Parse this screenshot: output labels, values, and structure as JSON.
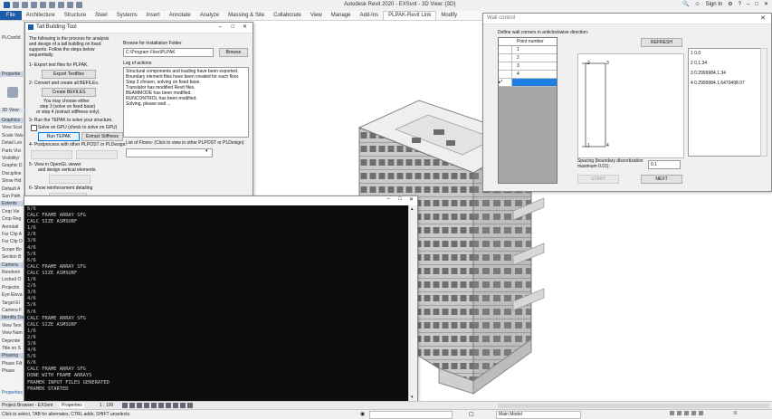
{
  "app": {
    "title": "Autodesk Revit 2020 - EXSvnt - 3D View: {3D}",
    "sign_in": "Sign In"
  },
  "ribbon": {
    "tabs": [
      "File",
      "Architecture",
      "Structure",
      "Steel",
      "Systems",
      "Insert",
      "Annotate",
      "Analyze",
      "Massing & Site",
      "Collaborate",
      "View",
      "Manage",
      "Add-Ins",
      "PLPAK-Revit Link",
      "Modify"
    ]
  },
  "left_panel": {
    "top_label": "PLConfid",
    "properties_label": "Propertie",
    "view_label": "3D View:",
    "rows": [
      "Graphics",
      "View Scal",
      "Scale Valu",
      "Detail Lev",
      "Parts Visi",
      "Visibility/",
      "Graphic D",
      "Discipline",
      "Show Hid",
      "Default A",
      "Sun Path",
      "Extents",
      "Crop Vie",
      "Crop Reg",
      "Annotati",
      "Far Clip A",
      "Far Clip O",
      "Scope Bo",
      "Section B",
      "Camera",
      "Renderin",
      "Locked O",
      "Projectio",
      "Eye Eleva",
      "Target El",
      "Camera F",
      "Identity Da",
      "View Tem",
      "View Nam",
      "Depende",
      "Title on S",
      "Phasing",
      "Phase Filt",
      "Phase"
    ],
    "properties_link": "Properties"
  },
  "tall_building": {
    "title": "Tall Building Tool",
    "intro": [
      "The following is the process for analysis",
      "and design of a tall building on fixed",
      "supports. Follow the steps below",
      "sequentially."
    ],
    "step1": "1- Export text files for PLPAK.",
    "export_button": "Export Textfiles",
    "step2": "2- Convert and create all BEFILEs.",
    "create_button": "Create BEFILES",
    "choose_note": [
      "You may choose either",
      "step 3 (solve on fixed base)",
      "or step 4 (extract stiffness only)."
    ],
    "step3": "3- Run the TEPAK to solve your structure.",
    "gpu_checkbox": "Solve on GPU (check to solve on GPU)",
    "run_button": "Run TEPAK",
    "extract_button": "Extract Stiffness",
    "step4": "4- Postprocess with other PLPOST or PLDesign.",
    "step5": "5- View in OpenGL viewer",
    "step5b": "and design vertical elements.",
    "step6": "6- Show reinforcement detailing",
    "browse_label": "Browse for Installation Folder",
    "path_value": "C:\\Program Files\\PLPAK",
    "browse_button": "Browse",
    "log_label": "Log of actions:",
    "log_lines": [
      "Structural components and loading have been exported.",
      "Boundary element files have been created for each floor.",
      "Step 3 chosen, solving on fixed base.",
      "Translator has modified Revit files.",
      "BEAMMODE has been modified.",
      "RUNCONTROL has been modified.",
      "Solving, please wait ..."
    ],
    "floors_label": "List of Floors: (Click to view in other PLPOST or PLDesign)"
  },
  "console": {
    "lines": [
      "6/6",
      "CALC FRAME ARRAY SFG",
      "CALC SIZE ASMSURF",
      "1/6",
      "2/6",
      "3/6",
      "4/6",
      "5/6",
      "6/6",
      "CALC FRAME ARRAY SFG",
      "CALC SIZE ASMSURF",
      "1/6",
      "2/6",
      "3/6",
      "4/6",
      "5/6",
      "6/6",
      "CALC FRAME ARRAY SFG",
      "CALC SIZE ASMSURF",
      "1/6",
      "2/6",
      "3/6",
      "4/6",
      "5/6",
      "6/6",
      "CALC FRAME ARRAY SFG",
      "DONE WITH FRAME ARRAYS",
      "FRAMEK INPUT FILES GENERATED",
      "FRAMEK STARTED"
    ]
  },
  "wall_control": {
    "title": "Wall control",
    "instruction": "Define wall corners in anticlockwise direction:",
    "table_header": "Point number",
    "table_rows": [
      "1",
      "2",
      "3",
      "4",
      ""
    ],
    "refresh_button": "REFRESH",
    "points_list": [
      "1   0.0",
      "2   0.1.34",
      "3   0.2999984.1.34",
      "4   0.2999984.1.6479498.07"
    ],
    "corner_labels": [
      "2",
      "3",
      "1",
      "4"
    ],
    "spacing_label": "Spacing (boundary discretization",
    "spacing_label2": "maximum 0.01):",
    "spacing_value": "0.1",
    "start_button": "START",
    "next_button": "NEXT"
  },
  "bottom": {
    "tabs": [
      "Project Browser - EXSvnt",
      "Properties"
    ],
    "scale": "1 : 100",
    "status": "Click to select, TAB for alternates, CTRL adds, SHIFT unselects.",
    "main_model": "Main Model",
    "zero": ":0"
  }
}
